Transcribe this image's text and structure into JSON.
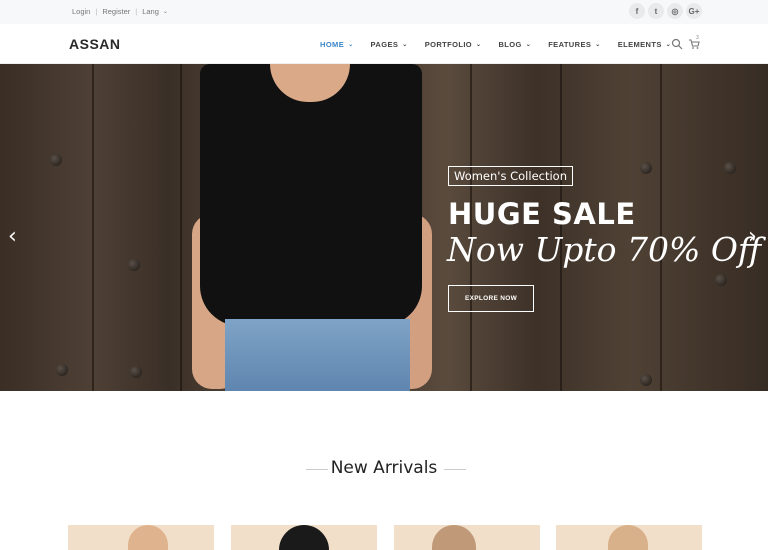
{
  "topbar": {
    "links": [
      "Login",
      "Register",
      "Lang"
    ],
    "socials": [
      {
        "name": "facebook-icon",
        "glyph": "f"
      },
      {
        "name": "twitter-icon",
        "glyph": "t"
      },
      {
        "name": "instagram-icon",
        "glyph": "◎"
      },
      {
        "name": "google-plus-icon",
        "glyph": "G+"
      }
    ]
  },
  "nav": {
    "logo": "ASSAN",
    "items": [
      "HOME",
      "PAGES",
      "PORTFOLIO",
      "BLOG",
      "FEATURES",
      "ELEMENTS"
    ],
    "active_item": "HOME",
    "cart_count": "3",
    "accent_color": "#3a86c8"
  },
  "hero": {
    "tag": "Women's Collection",
    "headline": "HUGE SALE",
    "subheadline": "Now Upto 70% Off",
    "cta": "EXPLORE NOW",
    "prev_icon": "chevron-left-icon",
    "next_icon": "chevron-right-icon"
  },
  "arrivals": {
    "title": "New Arrivals",
    "products_visible": 4
  }
}
